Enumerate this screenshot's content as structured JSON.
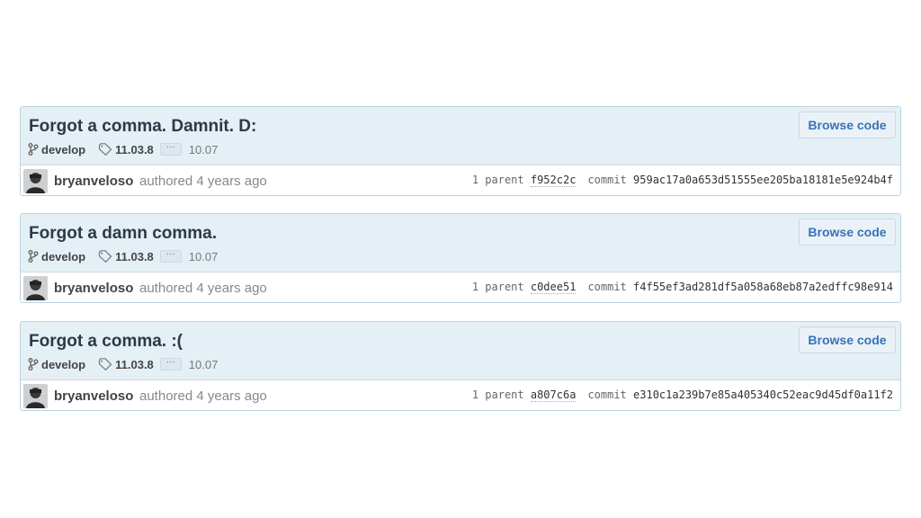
{
  "commits": [
    {
      "title": "Forgot a comma. Damnit. D:",
      "browse_label": "Browse code",
      "branch": "develop",
      "tag": "11.03.8",
      "ellipsis": "···",
      "tag_more": "10.07",
      "author": "bryanveloso",
      "authored_text": "authored 4 years ago",
      "parent_label": "1 parent ",
      "parent_sha": "f952c2c",
      "commit_label": "commit ",
      "commit_sha": "959ac17a0a653d51555ee205ba18181e5e924b4f"
    },
    {
      "title": "Forgot a damn comma.",
      "browse_label": "Browse code",
      "branch": "develop",
      "tag": "11.03.8",
      "ellipsis": "···",
      "tag_more": "10.07",
      "author": "bryanveloso",
      "authored_text": "authored 4 years ago",
      "parent_label": "1 parent ",
      "parent_sha": "c0dee51",
      "commit_label": "commit ",
      "commit_sha": "f4f55ef3ad281df5a058a68eb87a2edffc98e914"
    },
    {
      "title": "Forgot a comma. :(",
      "browse_label": "Browse code",
      "branch": "develop",
      "tag": "11.03.8",
      "ellipsis": "···",
      "tag_more": "10.07",
      "author": "bryanveloso",
      "authored_text": "authored 4 years ago",
      "parent_label": "1 parent ",
      "parent_sha": "a807c6a",
      "commit_label": "commit ",
      "commit_sha": "e310c1a239b7e85a405340c52eac9d45df0a11f2"
    }
  ],
  "icons": {
    "branch": "branch-icon",
    "tag": "tag-icon",
    "avatar": "avatar"
  },
  "colors": {
    "header_bg": "#e5eff6",
    "link_blue": "#3873b8",
    "border": "#bcd3e0"
  }
}
